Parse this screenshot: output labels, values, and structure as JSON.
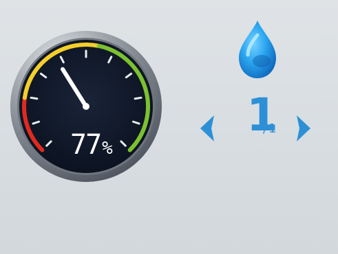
{
  "humidity_gauge": {
    "value": "77",
    "unit": "%",
    "level": 0.77,
    "colors": {
      "dial_face": "#111a2b",
      "bezel": "#8f969c",
      "low_arc": "#e02a20",
      "mid_arc": "#f4cf2a",
      "high_arc": "#7cc12f",
      "needle": "#ffffff",
      "tick": "#e8edf2"
    }
  },
  "water_level": {
    "main": "1",
    "sub": "/1",
    "accent_color": "#2d90d6",
    "drop_icon": "water-drop-icon",
    "left_icon": "chevron-left-icon",
    "right_icon": "chevron-right-icon"
  }
}
